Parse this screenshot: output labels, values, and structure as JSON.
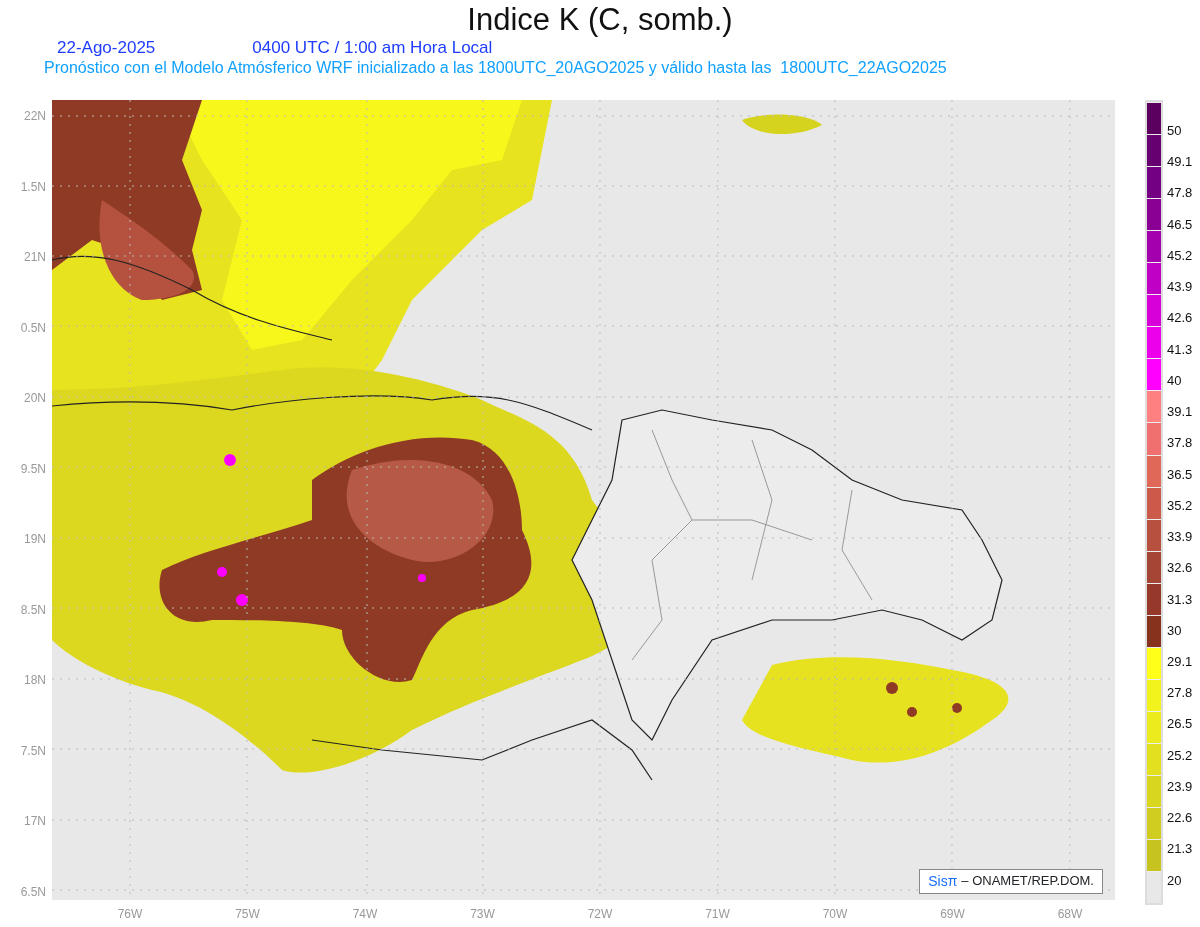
{
  "title": "Indice K (C, somb.)",
  "info": {
    "date": "22-Ago-2025",
    "time": "0400 UTC / 1:00 am Hora Local",
    "description": "Pronóstico con el Modelo Atmósferico WRF inicializado a las 1800UTC_20AGO2025 y válido hasta las  1800UTC_22AGO2025"
  },
  "y_axis": [
    "22N",
    "1.5N",
    "21N",
    "0.5N",
    "20N",
    "9.5N",
    "19N",
    "8.5N",
    "18N",
    "7.5N",
    "17N",
    "6.5N"
  ],
  "x_axis": [
    "76W",
    "75W",
    "74W",
    "73W",
    "72W",
    "71W",
    "70W",
    "69W",
    "68W"
  ],
  "colorbar": {
    "labels": [
      "50",
      "49.1",
      "47.8",
      "46.5",
      "45.2",
      "43.9",
      "42.6",
      "41.3",
      "40",
      "39.1",
      "37.8",
      "36.5",
      "35.2",
      "33.9",
      "32.6",
      "31.3",
      "30",
      "29.1",
      "27.8",
      "26.5",
      "25.2",
      "23.9",
      "22.6",
      "21.3",
      "20"
    ],
    "segments": [
      {
        "color": "#5c005f"
      },
      {
        "color": "#660070"
      },
      {
        "color": "#730082"
      },
      {
        "color": "#8a0094"
      },
      {
        "color": "#a500ad"
      },
      {
        "color": "#c000c4"
      },
      {
        "color": "#d800d8"
      },
      {
        "color": "#ec00ec"
      },
      {
        "color": "#ff00ff"
      },
      {
        "color": "#ff8080"
      },
      {
        "color": "#f07070"
      },
      {
        "color": "#e06858"
      },
      {
        "color": "#cc5a4a"
      },
      {
        "color": "#b85040"
      },
      {
        "color": "#a54535"
      },
      {
        "color": "#96382a"
      },
      {
        "color": "#86321c"
      },
      {
        "color": "#ffff1a"
      },
      {
        "color": "#f2f21c"
      },
      {
        "color": "#ebeb1e"
      },
      {
        "color": "#e2e01f"
      },
      {
        "color": "#d9d620"
      },
      {
        "color": "#d0cd20"
      },
      {
        "color": "#c6c21f"
      },
      {
        "color": "#e8e8e8"
      }
    ]
  },
  "credit": {
    "logo": "Sisπ",
    "text": "– ONAMET/REP.DOM."
  }
}
